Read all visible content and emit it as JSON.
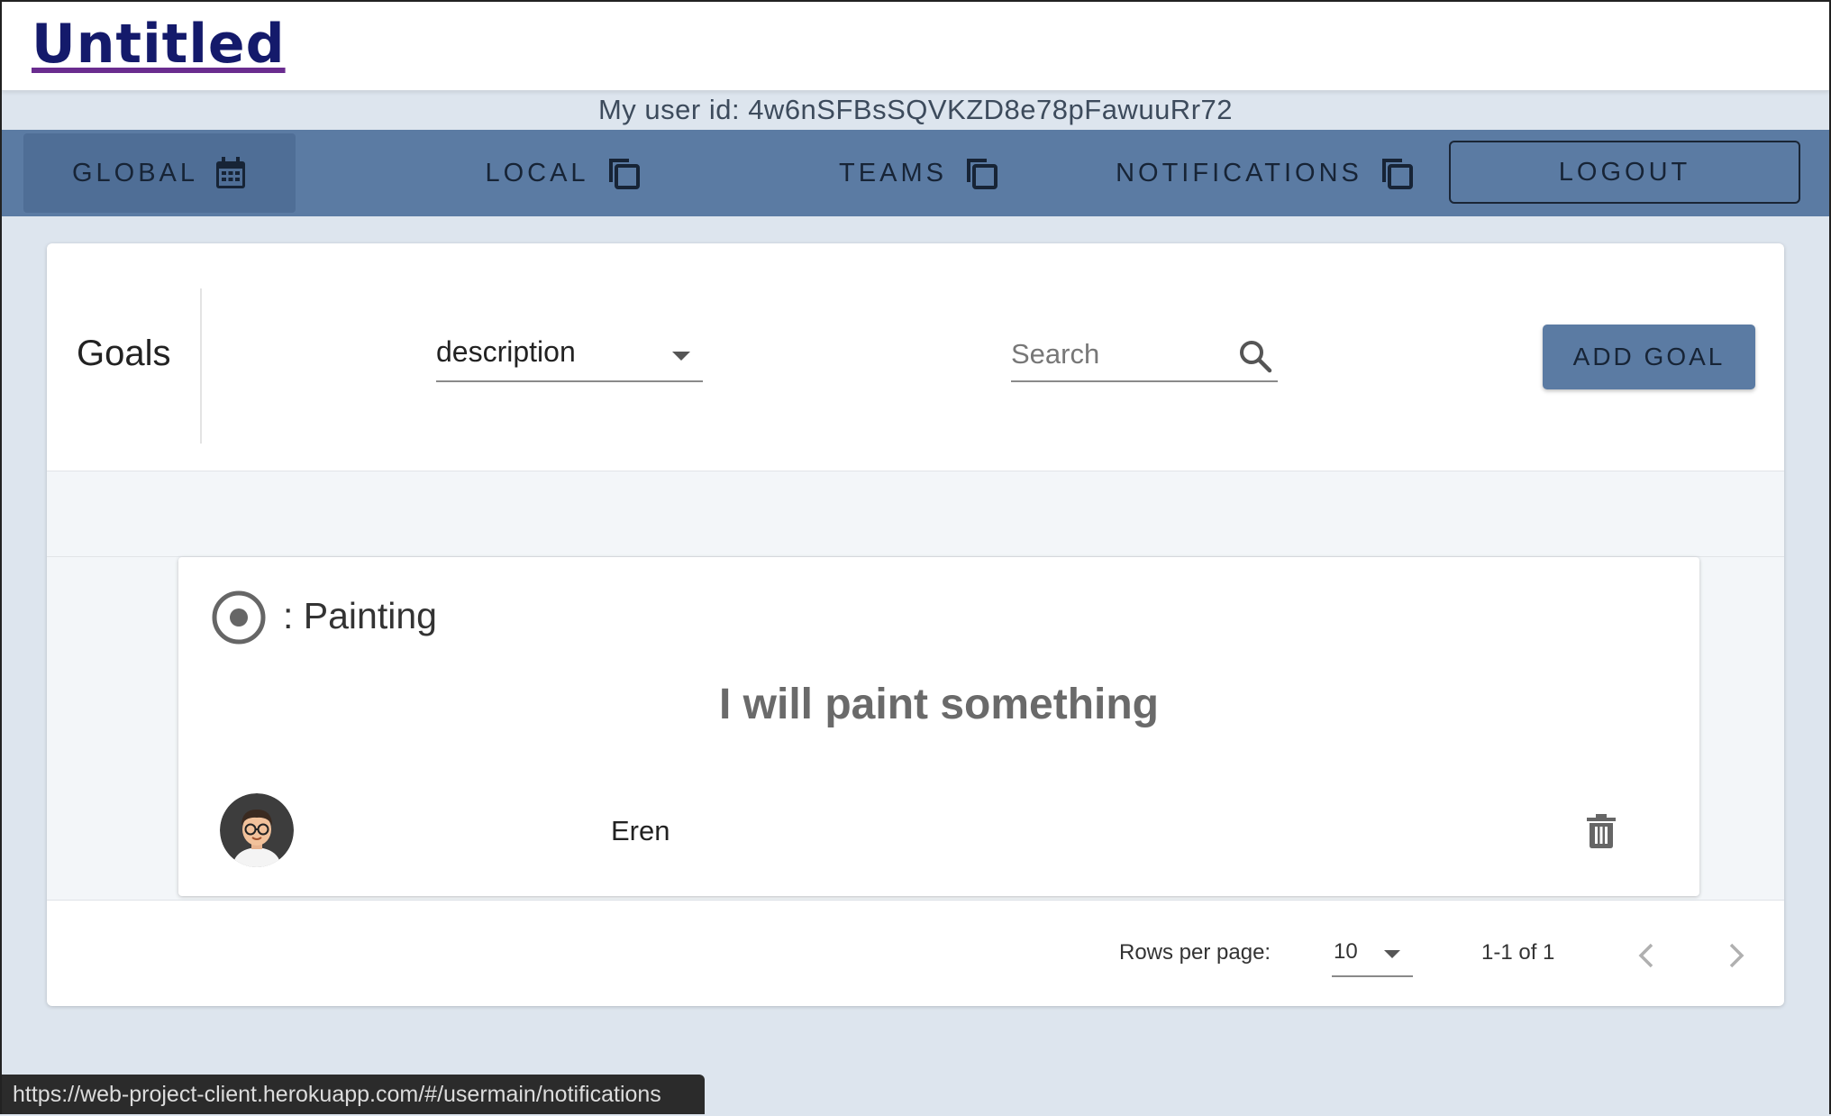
{
  "app": {
    "title": "Untitled"
  },
  "user": {
    "id_text": "My user id: 4w6nSFBsSQVKZD8e78pFawuuRr72"
  },
  "nav": {
    "tabs": [
      {
        "label": "GLOBAL",
        "icon": "calendar-icon",
        "active": true
      },
      {
        "label": "LOCAL",
        "icon": "copy-icon",
        "active": false
      },
      {
        "label": "TEAMS",
        "icon": "copy-icon",
        "active": false
      },
      {
        "label": "NOTIFICATIONS",
        "icon": "copy-icon",
        "active": false
      }
    ],
    "logout_label": "LOGOUT"
  },
  "goals": {
    "title": "Goals",
    "filter_value": "description",
    "search_placeholder": "Search",
    "add_label": "ADD GOAL",
    "items": [
      {
        "category": ": Painting",
        "description": "I will paint something",
        "user": "Eren",
        "status_icon": "radio-checked-icon",
        "delete_icon": "trash-icon"
      }
    ]
  },
  "pagination": {
    "rows_label": "Rows per page:",
    "rows_value": "10",
    "range_text": "1-1 of 1"
  },
  "status_bar": {
    "url": "https://web-project-client.herokuapp.com/#/usermain/notifications"
  },
  "colors": {
    "navbar": "#5b7ba3",
    "title": "#141a6b",
    "background": "#dde5ee"
  }
}
